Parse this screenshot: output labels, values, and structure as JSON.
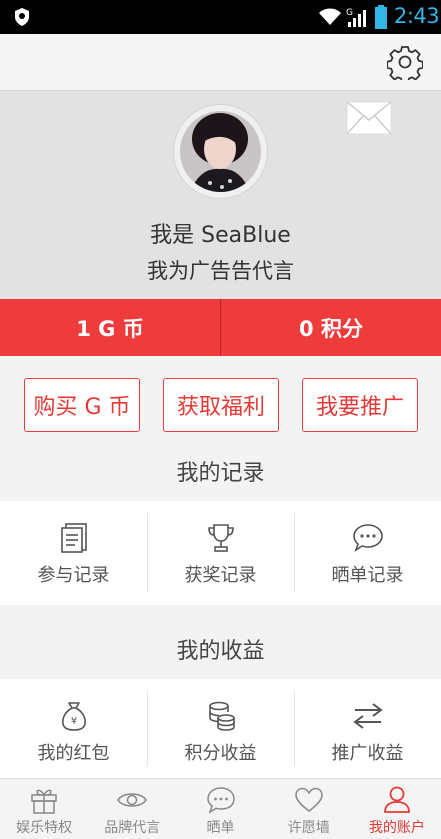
{
  "statusbar": {
    "time": "2:43"
  },
  "profile": {
    "name": "我是 SeaBlue",
    "slogan": "我为广告告代言"
  },
  "stats": {
    "coins": "1 G 币",
    "points": "0 积分"
  },
  "actions": {
    "buy": "购买 G 币",
    "benefits": "获取福利",
    "promote": "我要推广"
  },
  "records": {
    "title": "我的记录",
    "items": [
      {
        "label": "参与记录",
        "icon": "document-icon"
      },
      {
        "label": "获奖记录",
        "icon": "trophy-icon"
      },
      {
        "label": "晒单记录",
        "icon": "chat-bubble-icon"
      }
    ]
  },
  "earnings": {
    "title": "我的收益",
    "items": [
      {
        "label": "我的红包",
        "icon": "money-bag-icon"
      },
      {
        "label": "积分收益",
        "icon": "coin-stack-icon"
      },
      {
        "label": "推广收益",
        "icon": "swap-arrows-icon"
      }
    ]
  },
  "tabs": [
    {
      "label": "娱乐特权",
      "icon": "gift-icon"
    },
    {
      "label": "品牌代言",
      "icon": "eye-icon"
    },
    {
      "label": "晒单",
      "icon": "chat-bubble-icon"
    },
    {
      "label": "许愿墙",
      "icon": "heart-icon"
    },
    {
      "label": "我的账户",
      "icon": "user-icon",
      "active": true
    }
  ],
  "colors": {
    "accent": "#ee3c3c",
    "statusbar_icon": "#33b5e5"
  }
}
